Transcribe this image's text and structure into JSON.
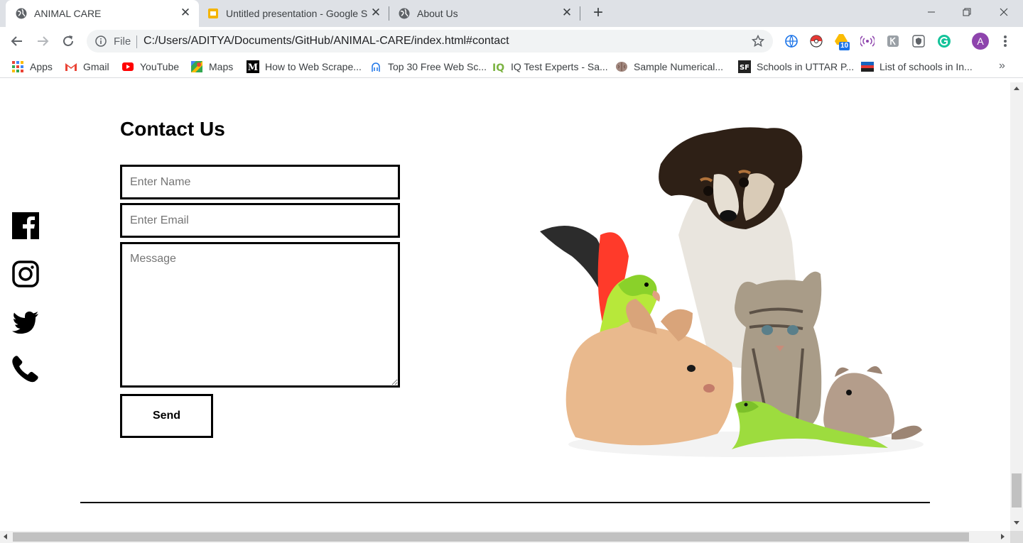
{
  "browser": {
    "tabs": [
      {
        "title": "ANIMAL CARE",
        "active": true,
        "icon": "globe-icon"
      },
      {
        "title": "Untitled presentation - Google Sl",
        "active": false,
        "icon": "google-slides-icon"
      },
      {
        "title": "About Us",
        "active": false,
        "icon": "globe-icon"
      }
    ],
    "omnibox": {
      "scheme_label": "File",
      "url": "C:/Users/ADITYA/Documents/GitHub/ANIMAL-CARE/index.html#contact"
    },
    "profile_initial": "A",
    "extension_badge": "10",
    "bookmarks": [
      {
        "label": "Apps",
        "icon": "apps-grid-icon"
      },
      {
        "label": "Gmail",
        "icon": "gmail-icon"
      },
      {
        "label": "YouTube",
        "icon": "youtube-icon"
      },
      {
        "label": "Maps",
        "icon": "maps-icon"
      },
      {
        "label": "How to Web Scrape...",
        "icon": "medium-icon"
      },
      {
        "label": "Top 30 Free Web Sc...",
        "icon": "octopus-icon"
      },
      {
        "label": "IQ Test Experts - Sa...",
        "icon": "iq-icon"
      },
      {
        "label": "Sample Numerical...",
        "icon": "brain-icon"
      },
      {
        "label": "Schools in UTTAR P...",
        "icon": "sf-icon"
      },
      {
        "label": "List of schools in In...",
        "icon": "flag-icon"
      }
    ],
    "bookmarks_overflow": "»"
  },
  "page": {
    "contact": {
      "title": "Contact Us",
      "name_placeholder": "Enter Name",
      "email_placeholder": "Enter Email",
      "message_placeholder": "Message",
      "send_label": "Send"
    },
    "social_icons": [
      "facebook-icon",
      "instagram-icon",
      "twitter-icon",
      "phone-icon"
    ],
    "illustration": "pets-group-illustration"
  },
  "colors": {
    "tabstrip": "#dee1e6",
    "omnibox": "#f1f3f4",
    "text": "#000000",
    "placeholder": "#757575"
  }
}
